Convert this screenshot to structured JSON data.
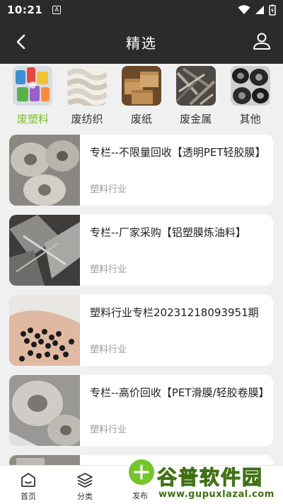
{
  "status": {
    "time": "10:21",
    "sim_label": "A"
  },
  "header": {
    "title": "精选"
  },
  "categories": [
    {
      "label": "废塑料",
      "active": true
    },
    {
      "label": "废纺织",
      "active": false
    },
    {
      "label": "废纸",
      "active": false
    },
    {
      "label": "废金属",
      "active": false
    },
    {
      "label": "其他",
      "active": false
    }
  ],
  "cards": [
    {
      "title": "专栏--不限量回收【透明PET轻胶膜】",
      "tag": "塑料行业"
    },
    {
      "title": "专栏--厂家采购【铝塑膜炼油料】",
      "tag": "塑料行业"
    },
    {
      "title": "塑料行业专栏20231218093951期",
      "tag": "塑料行业"
    },
    {
      "title": "专栏--高价回收【PET滑膜/轻胶卷膜】",
      "tag": "塑料行业"
    }
  ],
  "bottom_nav": {
    "home": "首页",
    "category": "分类",
    "publish": "发布"
  },
  "watermark": {
    "brand": "谷普软件园",
    "url": "www.gupuxlazal.com"
  },
  "colors": {
    "accent": "#7dbf2a",
    "header_bg": "#2b2b2b",
    "publish_bg": "#75c52c"
  }
}
